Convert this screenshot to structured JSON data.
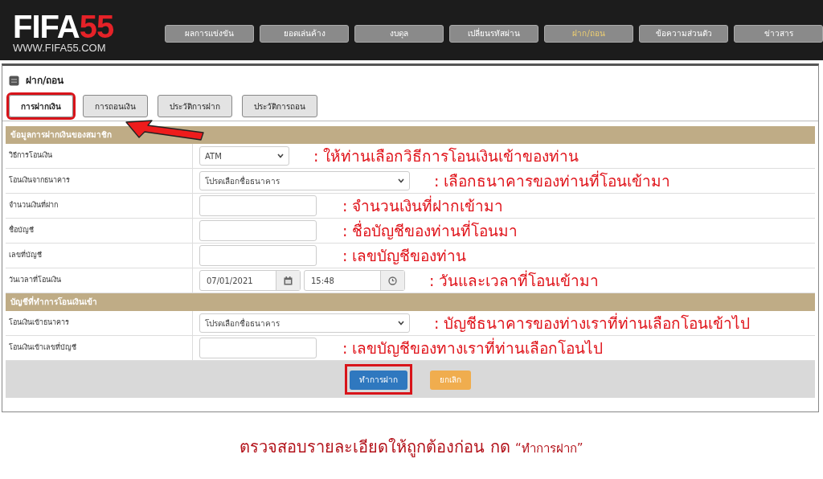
{
  "header": {
    "logo": "FIFA55",
    "logo_url": "WWW.FIFA55.COM",
    "nav": [
      {
        "label": "ผลการแข่งขัน",
        "selected": false
      },
      {
        "label": "ยอดเล่นค้าง",
        "selected": false
      },
      {
        "label": "งบดุล",
        "selected": false
      },
      {
        "label": "เปลี่ยนรหัสผ่าน",
        "selected": false
      },
      {
        "label": "ฝาก/ถอน",
        "selected": true
      },
      {
        "label": "ข้อความส่วนตัว",
        "selected": false
      },
      {
        "label": "ข่าวสาร",
        "selected": false
      }
    ]
  },
  "page_title": "ฝาก/ถอน",
  "tabs": [
    {
      "label": "การฝากเงิน",
      "selected": true,
      "highlighted": true
    },
    {
      "label": "การถอนเงิน",
      "selected": false,
      "highlighted": false
    },
    {
      "label": "ประวัติการฝาก",
      "selected": false,
      "highlighted": false
    },
    {
      "label": "ประวัติการถอน",
      "selected": false,
      "highlighted": false
    }
  ],
  "sections": [
    {
      "title": "ข้อมูลการฝากเงินของสมาชิก",
      "rows": [
        {
          "label": "วิธีการโอนเงิน",
          "kind": "short-select",
          "value": "ATM",
          "note": ": ให้ท่านเลือกวิธีการโอนเงินเข้าของท่าน"
        },
        {
          "label": "โอนเงินจากธนาคาร",
          "kind": "select",
          "value": "โปรดเลือกชื่อธนาคาร",
          "note": ": เลือกธนาคารของท่านที่โอนเข้ามา"
        },
        {
          "label": "จำนวนเงินที่ฝาก",
          "kind": "input",
          "note": ": จำนวนเงินที่ฝากเข้ามา"
        },
        {
          "label": "ชื่อบัญชี",
          "kind": "input",
          "note": ": ชื่อบัญชีของท่านที่โอนมา"
        },
        {
          "label": "เลขที่บัญชี",
          "kind": "input",
          "note": ": เลขบัญชีของท่าน"
        },
        {
          "label": "วันเวลาที่โอนเงิน",
          "kind": "datetime",
          "date": "07/01/2021",
          "time": "15:48",
          "note": ": วันและเวลาที่โอนเข้ามา"
        }
      ]
    },
    {
      "title": "บัญชีที่ทำการโอนเงินเข้า",
      "rows": [
        {
          "label": "โอนเงินเข้าธนาคาร",
          "kind": "select",
          "value": "โปรดเลือกชื่อธนาคาร",
          "note": ": บัญชีธนาคารของท่างเราที่ท่านเลือกโอนเข้าไป"
        },
        {
          "label": "โอนเงินเข้าเลขที่บัญชี",
          "kind": "input",
          "note": ": เลขบัญชีของทางเราที่ท่านเลือกโอนไป"
        }
      ]
    }
  ],
  "buttons": [
    {
      "label": "ทำการฝาก",
      "kind": "primary",
      "highlighted": true
    },
    {
      "label": "ยกเลิก",
      "kind": "warning",
      "highlighted": false
    }
  ],
  "caption": {
    "text": "ตรวจสอบรายละเอียดให้ถูกต้องก่อน กด",
    "quote": "“ทำการฝาก”"
  }
}
